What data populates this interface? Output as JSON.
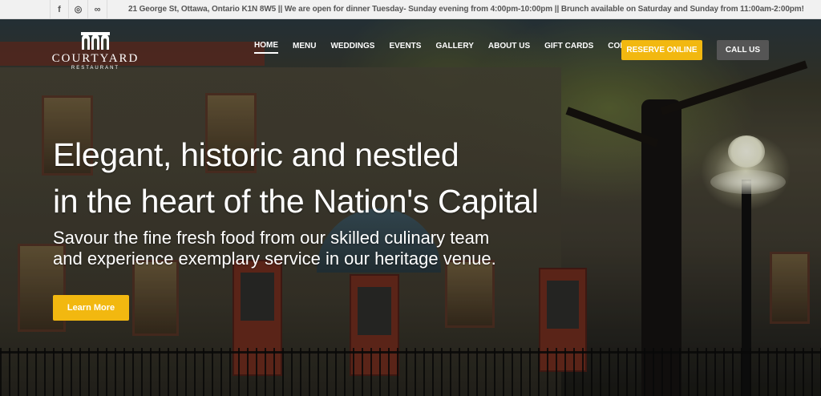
{
  "topbar": {
    "social": [
      {
        "icon": "facebook-icon",
        "glyph": "f"
      },
      {
        "icon": "instagram-icon",
        "glyph": "◎"
      },
      {
        "icon": "tripadvisor-icon",
        "glyph": "∞"
      }
    ],
    "info": "21 George St, Ottawa, Ontario K1N 8W5 || We are open for dinner Tuesday- Sunday evening from 4:00pm-10:00pm || Brunch available on Saturday and Sunday from 11:00am-2:00pm!"
  },
  "logo": {
    "name": "COURTYARD",
    "sub": "RESTAURANT"
  },
  "nav": {
    "items": [
      "HOME",
      "MENU",
      "WEDDINGS",
      "EVENTS",
      "GALLERY",
      "ABOUT US",
      "GIFT CARDS",
      "CONTACT US"
    ],
    "active": "HOME",
    "reserve_label": "RESERVE ONLINE",
    "call_label": "CALL US"
  },
  "hero": {
    "headline_line1": "Elegant, historic and nestled",
    "headline_line2": "in the heart of the Nation's Capital",
    "sub_line1": "Savour the fine fresh food from our skilled culinary team",
    "sub_line2": "and experience exemplary service in our heritage venue.",
    "button_label": "Learn More"
  },
  "colors": {
    "accent": "#f2b810",
    "call_button": "#555555",
    "topbar_bg": "#f1f1f1"
  }
}
